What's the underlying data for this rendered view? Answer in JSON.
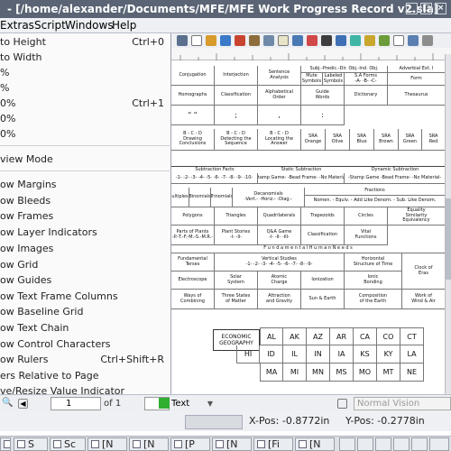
{
  "window": {
    "title": "- [/home/alexander/Documents/MFE/MFE Work Progress Record v2.sla]"
  },
  "menubar": {
    "items": [
      "Extras",
      "Script",
      "Windows",
      "Help"
    ]
  },
  "view_menu": {
    "items": [
      {
        "label": "to Height",
        "shortcut": "Ctrl+0"
      },
      {
        "label": "to Width",
        "shortcut": ""
      },
      {
        "label": "%",
        "shortcut": ""
      },
      {
        "label": "%",
        "shortcut": ""
      },
      {
        "label": "0%",
        "shortcut": "Ctrl+1"
      },
      {
        "label": "0%",
        "shortcut": ""
      },
      {
        "label": "0%",
        "shortcut": ""
      },
      {
        "label": "view Mode",
        "shortcut": ""
      },
      {
        "label": "ow Margins",
        "shortcut": ""
      },
      {
        "label": "ow Bleeds",
        "shortcut": ""
      },
      {
        "label": "ow Frames",
        "shortcut": ""
      },
      {
        "label": "ow Layer Indicators",
        "shortcut": ""
      },
      {
        "label": "ow Images",
        "shortcut": ""
      },
      {
        "label": "ow Grid",
        "shortcut": ""
      },
      {
        "label": "ow Guides",
        "shortcut": ""
      },
      {
        "label": "ow Text Frame Columns",
        "shortcut": ""
      },
      {
        "label": "ow Baseline Grid",
        "shortcut": ""
      },
      {
        "label": "ow Text Chain",
        "shortcut": ""
      },
      {
        "label": "ow Control Characters",
        "shortcut": ""
      },
      {
        "label": "ow Rulers",
        "shortcut": "Ctrl+Shift+R"
      },
      {
        "label": "ers Relative to Page",
        "shortcut": ""
      },
      {
        "label": "ve/Resize Value Indicator",
        "shortcut": ""
      }
    ]
  },
  "document": {
    "row1": [
      "Conjugation",
      "Interjection",
      "Sentence\nAnalysis",
      "Subj.-Predic.-Dir. Obj.-Ind. Obj.",
      "Adverbial Ext. I"
    ],
    "row1_sub": [
      "Mute\nSymbols",
      "Labeled\nSymbols",
      "S.A Forms\n-A-  -B-  -C-",
      "Form"
    ],
    "row2": [
      "Homographs",
      "Classification",
      "Alphabetical\nOrder",
      "Guide\nWords",
      "Dictionary",
      "Thesaurus"
    ],
    "row3": [
      "\" \"",
      ";",
      ",",
      ":"
    ],
    "row4a": [
      "B - C - D\nDrawing\nConclusions",
      "B - C - D\nDetecting the\nSequence",
      "B - C - D\nLocating the\nAnswer"
    ],
    "row4b": [
      "SRA\nOrange",
      "SRA\nOlive",
      "SRA\nBlue",
      "SRA\nBrown",
      "SRA\nGreen",
      "SRA\nRed"
    ],
    "sub_heads": [
      "Subtraction Facts",
      "Static Subtraction",
      "Dynamic Subtraction"
    ],
    "sub_row": [
      "-1- -2- -3- -4- -5- -6- -7- -8- -9- -10-",
      "-Stamp Game-  -Bead Frame-  -No Material-",
      "-Stamp Game  -Bead Frame-  -No Material-"
    ],
    "mult_row": [
      "ultiples",
      "Binomials",
      "Trinomials",
      "Decanomials\n-Vert.-  -Horiz.-  -Diag.-",
      "Fractions",
      "Nomen.  -  Equiv.  -  Add Like Denom.  -  Sub. Like Denom."
    ],
    "geom_row": [
      "Polygons",
      "Triangles",
      "Quadrilaterals",
      "Trapezoids",
      "Circles",
      "Equality\nSimilarity\nEquivalency"
    ],
    "plants_row": [
      "Parts of Plants\n-P.-T.-F.-M.-S.-M.R.-",
      "Plant Stories\n-I- -II-",
      "Q&A Game\n-I- -II- -III-",
      "Classification",
      "Vital\nFunctions"
    ],
    "needs_row": [
      "F u n d a m e n t a l     H u m a n     N e e d s"
    ],
    "terses_row": [
      "Fundamental\nTerses",
      "Vertical Studies\n-1- -2- -3- -4- -5- -6- -7- -8- -9-",
      "Horizontal\nStructure of Time",
      "Clock of\nEras"
    ],
    "electro_row": [
      "Electroscope",
      "Solar\nSystem",
      "Atomic\nCharge",
      "Ionization",
      "Ionic\nBonding"
    ],
    "combine_row": [
      "Ways of\nCombining",
      "Three States\nof Matter",
      "Attraction\nand Gravity",
      "Sun & Earth",
      "Composition\nof the Earth",
      "Work of\nWind & Air"
    ],
    "econ_geo": "Economic\nGeography",
    "states_row1": [
      "AL",
      "AK",
      "AZ",
      "AR",
      "CA",
      "CO",
      "CT"
    ],
    "states_row2": [
      "HI",
      "ID",
      "IL",
      "IN",
      "IA",
      "KS",
      "KY",
      "LA"
    ],
    "states_row3": [
      "MA",
      "MI",
      "MN",
      "MS",
      "MO",
      "MT",
      "NE"
    ]
  },
  "bottombar": {
    "page_value": "1",
    "page_of": "of 1",
    "layer_value": "Text",
    "preview_value": "Normal Vision"
  },
  "status": {
    "x_pos": "X-Pos: -0.8772in",
    "y_pos": "Y-Pos: -0.2778in"
  },
  "taskbar": {
    "items": [
      "S",
      "Sc",
      "[N",
      "[N",
      "[P",
      "[N",
      "[Fi",
      "[N"
    ]
  },
  "colors": {
    "titlebar": "#5a6474",
    "accent_green": "#2fae2f"
  }
}
